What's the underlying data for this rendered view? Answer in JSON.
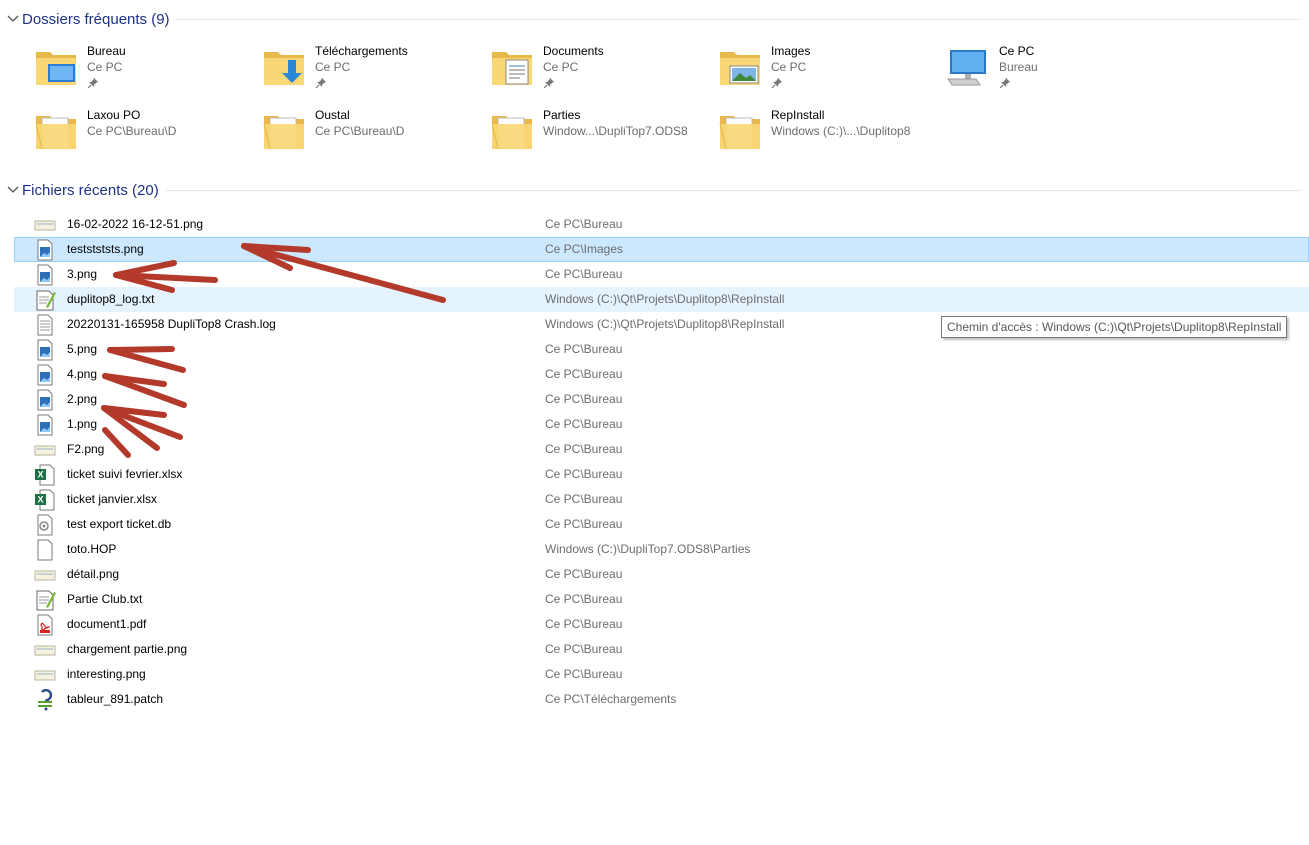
{
  "frequent": {
    "title": "Dossiers fréquents (9)",
    "items": [
      {
        "name": "Bureau",
        "location": "Ce PC",
        "pinned": true,
        "icon": "desktop-folder-icon"
      },
      {
        "name": "Téléchargements",
        "location": "Ce PC",
        "pinned": true,
        "icon": "downloads-folder-icon"
      },
      {
        "name": "Documents",
        "location": "Ce PC",
        "pinned": true,
        "icon": "documents-folder-icon"
      },
      {
        "name": "Images",
        "location": "Ce PC",
        "pinned": true,
        "icon": "pictures-folder-icon"
      },
      {
        "name": "Ce PC",
        "location": "Bureau",
        "pinned": true,
        "icon": "this-pc-icon"
      },
      {
        "name": "Laxou PO",
        "location": "Ce PC\\Bureau\\D",
        "pinned": false,
        "icon": "folder-icon"
      },
      {
        "name": "Oustal",
        "location": "Ce PC\\Bureau\\D",
        "pinned": false,
        "icon": "folder-icon"
      },
      {
        "name": "Parties",
        "location": "Window...\\DupliTop7.ODS8",
        "pinned": false,
        "icon": "folder-icon"
      },
      {
        "name": "RepInstall",
        "location": "Windows (C:)\\...\\Duplitop8",
        "pinned": false,
        "icon": "folder-icon"
      }
    ]
  },
  "recent": {
    "title": "Fichiers récents (20)",
    "files": [
      {
        "name": "16-02-2022 16-12-51.png",
        "path": "Ce PC\\Bureau",
        "icon": "thumbnail-icon"
      },
      {
        "name": "teststststs.png",
        "path": "Ce PC\\Images",
        "icon": "image-file-icon"
      },
      {
        "name": "3.png",
        "path": "Ce PC\\Bureau",
        "icon": "image-file-icon"
      },
      {
        "name": "duplitop8_log.txt",
        "path": "Windows (C:)\\Qt\\Projets\\Duplitop8\\RepInstall",
        "icon": "notepad-plus-file-icon"
      },
      {
        "name": "20220131-165958 DupliTop8 Crash.log",
        "path": "Windows (C:)\\Qt\\Projets\\Duplitop8\\RepInstall",
        "icon": "text-file-icon"
      },
      {
        "name": "5.png",
        "path": "Ce PC\\Bureau",
        "icon": "image-file-icon"
      },
      {
        "name": "4.png",
        "path": "Ce PC\\Bureau",
        "icon": "image-file-icon"
      },
      {
        "name": "2.png",
        "path": "Ce PC\\Bureau",
        "icon": "image-file-icon"
      },
      {
        "name": "1.png",
        "path": "Ce PC\\Bureau",
        "icon": "image-file-icon"
      },
      {
        "name": "F2.png",
        "path": "Ce PC\\Bureau",
        "icon": "thumbnail-icon"
      },
      {
        "name": "ticket suivi fevrier.xlsx",
        "path": "Ce PC\\Bureau",
        "icon": "excel-file-icon"
      },
      {
        "name": "ticket janvier.xlsx",
        "path": "Ce PC\\Bureau",
        "icon": "excel-file-icon"
      },
      {
        "name": "test export ticket.db",
        "path": "Ce PC\\Bureau",
        "icon": "db-file-icon"
      },
      {
        "name": "toto.HOP",
        "path": "Windows (C:)\\DupliTop7.ODS8\\Parties",
        "icon": "blank-file-icon"
      },
      {
        "name": "détail.png",
        "path": "Ce PC\\Bureau",
        "icon": "thumbnail-icon"
      },
      {
        "name": "Partie Club.txt",
        "path": "Ce PC\\Bureau",
        "icon": "notepad-plus-file-icon"
      },
      {
        "name": "document1.pdf",
        "path": "Ce PC\\Bureau",
        "icon": "pdf-file-icon"
      },
      {
        "name": "chargement partie.png",
        "path": "Ce PC\\Bureau",
        "icon": "thumbnail-icon"
      },
      {
        "name": "interesting.png",
        "path": "Ce PC\\Bureau",
        "icon": "thumbnail-icon"
      },
      {
        "name": "tableur_891.patch",
        "path": "Ce PC\\Téléchargements",
        "icon": "patch-file-icon"
      }
    ],
    "selected_row": "teststststs.png",
    "hovered_row": "duplitop8_log.txt"
  },
  "tooltip": {
    "text": "Chemin d'accès : Windows (C:)\\Qt\\Projets\\Duplitop8\\RepInstall"
  },
  "annotations": {
    "arrow_color": "#b33a2a",
    "pointing_at": [
      "teststststs.png",
      "3.png",
      "5.png",
      "4.png",
      "2.png",
      "1.png"
    ]
  },
  "colors": {
    "header_blue": "#1e3287",
    "selected_bg": "#cce8ff",
    "hover_bg": "#e5f3ff",
    "secondary_text": "#6d6d6d",
    "folder_yellow": "#f8d775"
  }
}
